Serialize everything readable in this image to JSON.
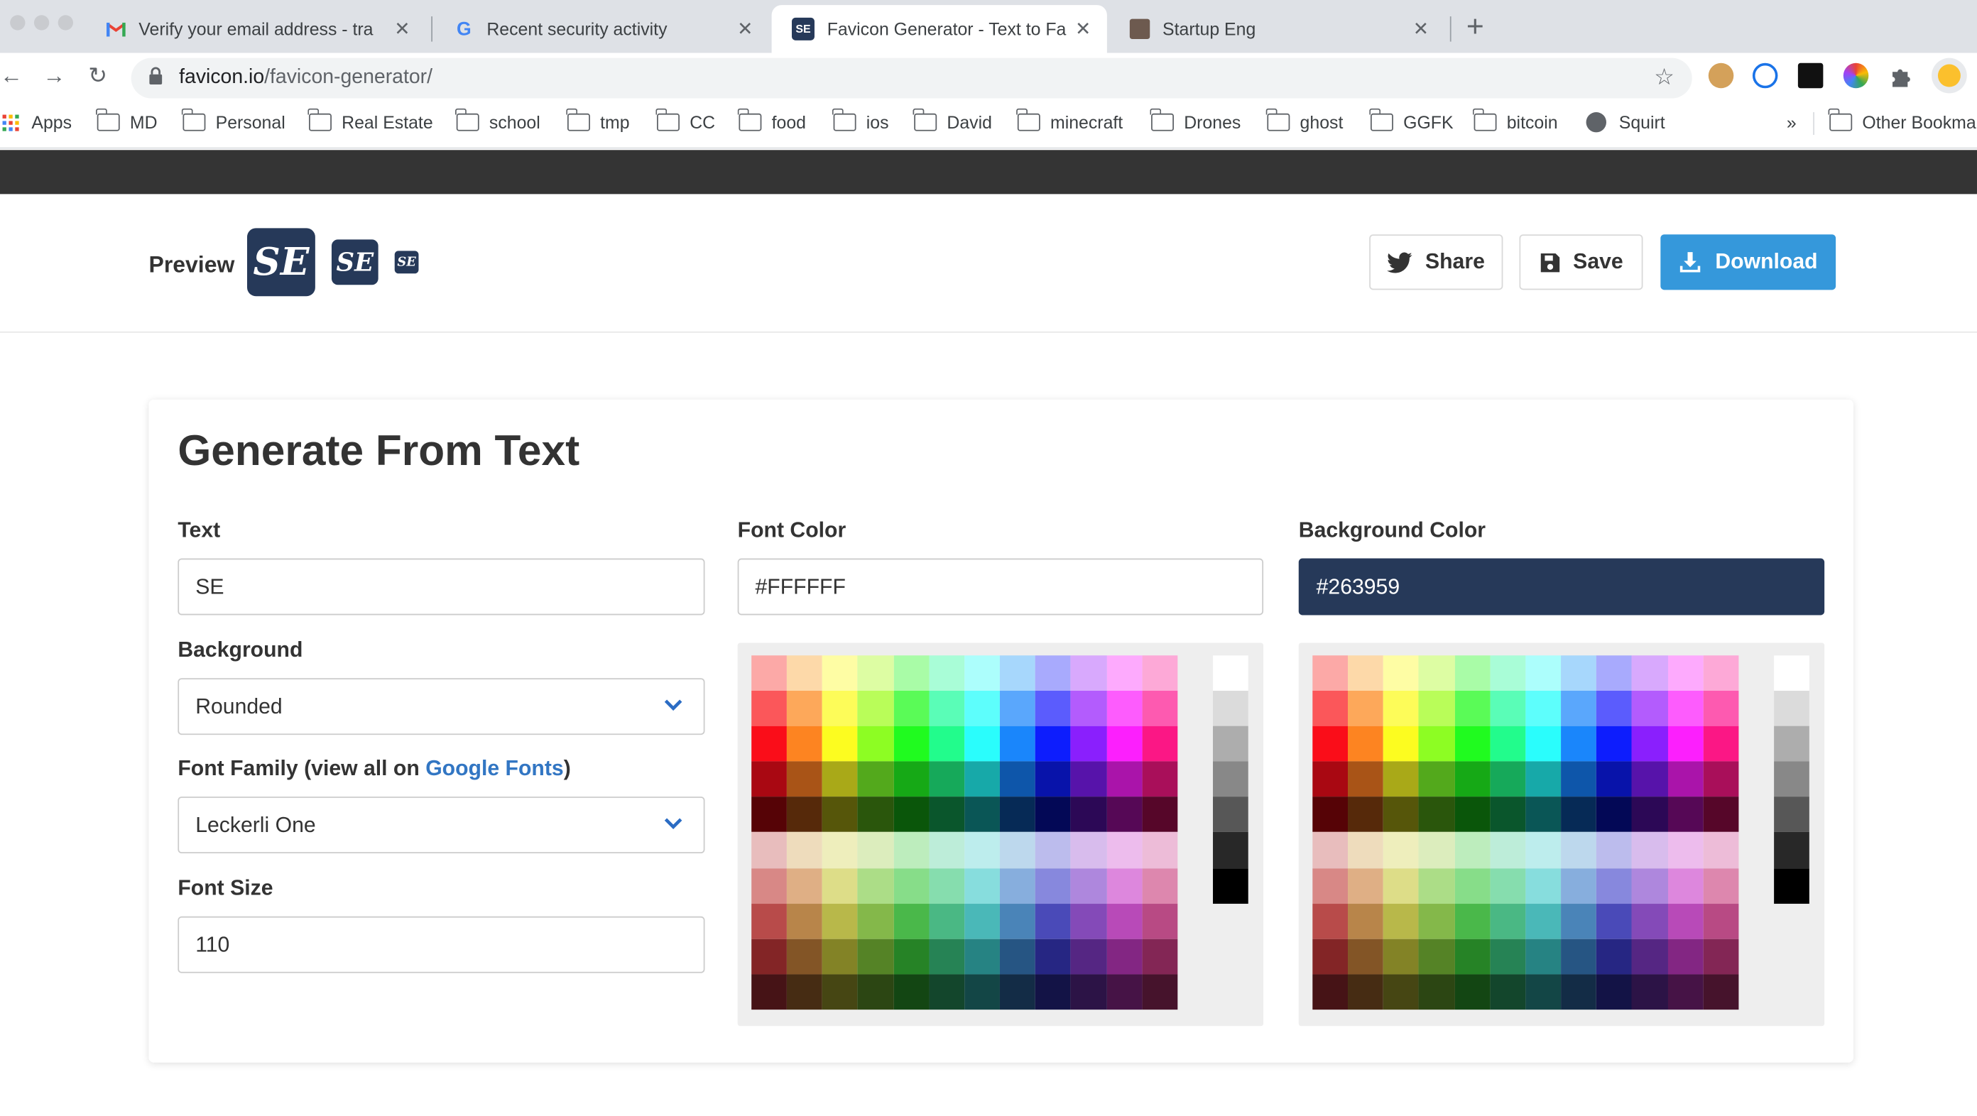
{
  "browser": {
    "tabs": [
      {
        "title": "Verify your email address - tra",
        "favicon": "gmail-icon"
      },
      {
        "title": "Recent security activity",
        "favicon": "google-icon"
      },
      {
        "title": "Favicon Generator - Text to Fa",
        "favicon": "favicon-io-icon",
        "active": true
      },
      {
        "title": "Startup Eng",
        "favicon": "avatar-icon"
      }
    ],
    "url_domain": "favicon.io",
    "url_path": "/favicon-generator/",
    "bookmarks": [
      "Apps",
      "MD",
      "Personal",
      "Real Estate",
      "school",
      "tmp",
      "CC",
      "food",
      "ios",
      "David",
      "minecraft",
      "Drones",
      "ghost",
      "GGFK",
      "bitcoin",
      "Squirt"
    ],
    "bookmarks_overflow": "»",
    "other_bookmarks": "Other Bookma"
  },
  "preview": {
    "label": "Preview",
    "icon_text": "SE"
  },
  "actions": {
    "share": "Share",
    "save": "Save",
    "download": "Download"
  },
  "form": {
    "heading": "Generate From Text",
    "text_label": "Text",
    "text_value": "SE",
    "background_label": "Background",
    "background_value": "Rounded",
    "font_family_label_prefix": "Font Family (view all on ",
    "font_family_link": "Google Fonts",
    "font_family_label_suffix": ")",
    "font_family_value": "Leckerli One",
    "font_size_label": "Font Size",
    "font_size_value": "110",
    "font_color_label": "Font Color",
    "font_color_value": "#FFFFFF",
    "background_color_label": "Background Color",
    "background_color_value": "#263959"
  },
  "colors": {
    "accent": "#3598db",
    "favicon_bg": "#263959",
    "header_bar": "#343434",
    "link": "#3276c3"
  },
  "palette": {
    "rows": [
      [
        "#fca9a7",
        "#fdd9a9",
        "#fefda4",
        "#ddfda3",
        "#a9fca7",
        "#a9fdd7",
        "#acfefc",
        "#a7d7fc",
        "#a8aafd",
        "#d8a9fd",
        "#fdaafd",
        "#fda9d7"
      ],
      [
        "#fb575a",
        "#fda85a",
        "#fdfc59",
        "#b9fd59",
        "#5afb57",
        "#5afdb7",
        "#5dfefc",
        "#5aa7fc",
        "#5b5cfd",
        "#b35cfd",
        "#fd5cfd",
        "#fd5ab0"
      ],
      [
        "#fa0d19",
        "#fd8421",
        "#fcfc20",
        "#8dfd23",
        "#20fb1f",
        "#22fc8c",
        "#2afdfc",
        "#1a86fb",
        "#0d1dfd",
        "#8a1ffd",
        "#fc1ffd",
        "#fb1785"
      ],
      [
        "#a90812",
        "#a95417",
        "#a9a918",
        "#53a91c",
        "#16a916",
        "#16a95a",
        "#17a9a9",
        "#0e56aa",
        "#0813aa",
        "#5713aa",
        "#aa14aa",
        "#a90f5a"
      ],
      [
        "#560306",
        "#56290a",
        "#56560a",
        "#2a560c",
        "#0a560a",
        "#0a562c",
        "#0a5656",
        "#062a56",
        "#030856",
        "#2c0856",
        "#560856",
        "#560629"
      ],
      [
        "#e8bdbd",
        "#eedcbc",
        "#eeeebc",
        "#dcedbd",
        "#bdedbd",
        "#bdedd9",
        "#bdeded",
        "#bdd8ed",
        "#bcbced",
        "#d8bced",
        "#edbced",
        "#edbcd8"
      ],
      [
        "#d88886",
        "#dfaf85",
        "#dddd88",
        "#acdd87",
        "#87dd89",
        "#86ddae",
        "#87dddd",
        "#87aedd",
        "#8788dd",
        "#ae87dd",
        "#dd87dd",
        "#dd87ae"
      ],
      [
        "#b84b4a",
        "#b8854a",
        "#b8b84a",
        "#84b84a",
        "#4ab84a",
        "#4ab884",
        "#4ab8b8",
        "#4a84b8",
        "#4a4ab8",
        "#844ab8",
        "#b84ab8",
        "#b84a84"
      ],
      [
        "#832526",
        "#835526",
        "#838326",
        "#558326",
        "#268326",
        "#268355",
        "#268383",
        "#265583",
        "#262683",
        "#552683",
        "#832683",
        "#832655"
      ],
      [
        "#461316",
        "#462c13",
        "#464613",
        "#2c4613",
        "#134613",
        "#13462c",
        "#134646",
        "#132c46",
        "#131346",
        "#2c1346",
        "#461346",
        "#46132c"
      ]
    ],
    "grays": [
      "#ffffff",
      "#dbdbdb",
      "#adadad",
      "#888888",
      "#575757",
      "#282828",
      "#000000"
    ]
  }
}
